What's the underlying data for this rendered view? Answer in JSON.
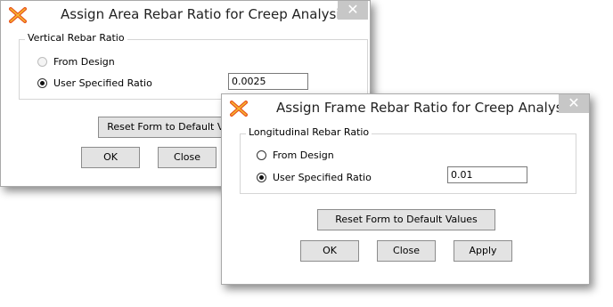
{
  "area_dialog": {
    "title": "Assign Area Rebar Ratio for Creep Analysis",
    "close_glyph": "✕",
    "group_label": "Vertical Rebar Ratio",
    "options": [
      {
        "label": "From Design",
        "selected": false,
        "enabled": false
      },
      {
        "label": "User Specified Ratio",
        "selected": true,
        "enabled": true
      }
    ],
    "ratio_value": "0.0025",
    "reset_label": "Reset Form to Default Values",
    "ok_label": "OK",
    "close_label": "Close"
  },
  "frame_dialog": {
    "title": "Assign Frame Rebar Ratio for Creep Analysis",
    "close_glyph": "✕",
    "group_label": "Longitudinal Rebar Ratio",
    "options": [
      {
        "label": "From Design",
        "selected": false,
        "enabled": true
      },
      {
        "label": "User Specified Ratio",
        "selected": true,
        "enabled": true
      }
    ],
    "ratio_value": "0.01",
    "reset_label": "Reset Form to Default Values",
    "ok_label": "OK",
    "close_label": "Close",
    "apply_label": "Apply"
  },
  "icons": {
    "app_icon": "sap-app-icon",
    "close_icon": "close-icon"
  },
  "colors": {
    "app_icon_primary": "#e8541c",
    "app_icon_secondary": "#f7b731"
  }
}
